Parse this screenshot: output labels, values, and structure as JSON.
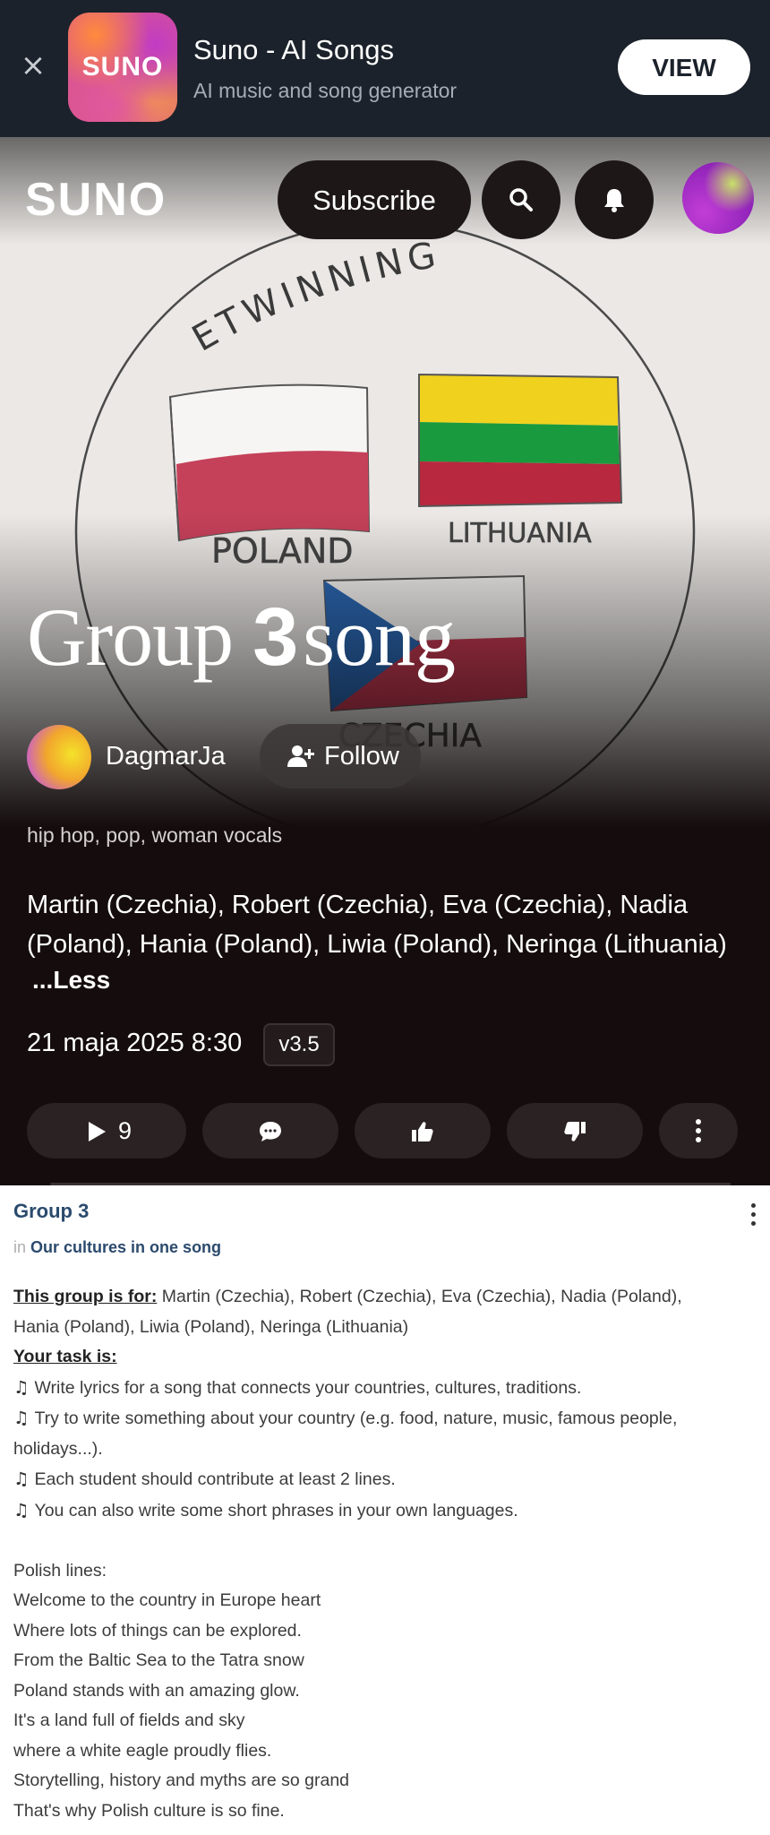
{
  "banner": {
    "close_icon": "close-icon",
    "app_icon_text": "SUNO",
    "app_name": "Suno - AI Songs",
    "app_subtitle": "AI music and song generator",
    "view_label": "VIEW"
  },
  "header": {
    "logo": "SUNO",
    "subscribe_label": "Subscribe",
    "icons": [
      "search-icon",
      "bell-icon",
      "avatar"
    ]
  },
  "song": {
    "title_part1": "Group ",
    "title_part2": "3",
    "title_part3": "song",
    "artist": "DagmarJa",
    "follow_label": "Follow",
    "tags": "hip hop, pop, woman vocals",
    "description": "Martin (Czechia), Robert (Czechia), Eva (Czechia), Nadia (Poland), Hania (Poland), Liwia (Poland), Neringa (Lithuania)",
    "less_label": "...Less",
    "date": "21 maja 2025 8:30",
    "version": "v3.5",
    "play_count": "9"
  },
  "cover_art": {
    "arc_text": "ETWINNING",
    "label_poland": "POLAND",
    "label_lithuania": "LITHUANIA",
    "label_czechia": "CZECHIA",
    "colors": {
      "poland_red": "#c5415a",
      "lithuania_yellow": "#f0d21e",
      "lithuania_green": "#1a9a3e",
      "lithuania_red": "#b8283e",
      "czech_blue": "#2c68b3",
      "czech_red": "#c63a52"
    }
  },
  "document": {
    "title": "Group 3",
    "in_prefix": "in",
    "course": "Our cultures in one song",
    "for_label": "This group is for:",
    "for_text": " Martin (Czechia), Robert (Czechia), Eva (Czechia), Nadia (Poland),",
    "for_text_2": "Hania (Poland), Liwia (Poland), Neringa  (Lithuania)",
    "task_label": "Your task is:",
    "note_icon": "♫",
    "task_1": "Write lyrics for a song that connects your countries, cultures, traditions.",
    "task_2": "Try to write something about your country (e.g. food, nature, music, famous people,",
    "task_2b": "holidays...).",
    "task_3": "Each student should contribute at least 2 lines.",
    "task_4": "You can also write some short phrases in your own languages.",
    "polish_label": "Polish lines:",
    "lines": [
      "Welcome to the country in Europe heart",
      "Where lots of things can be explored.",
      "From the Baltic Sea to the Tatra snow",
      "Poland stands with an amazing glow.",
      "It's a land full of fields and sky",
      "where a white eagle proudly flies.",
      "Storytelling, history and myths are so grand",
      "That's why Polish culture is so fine."
    ]
  }
}
